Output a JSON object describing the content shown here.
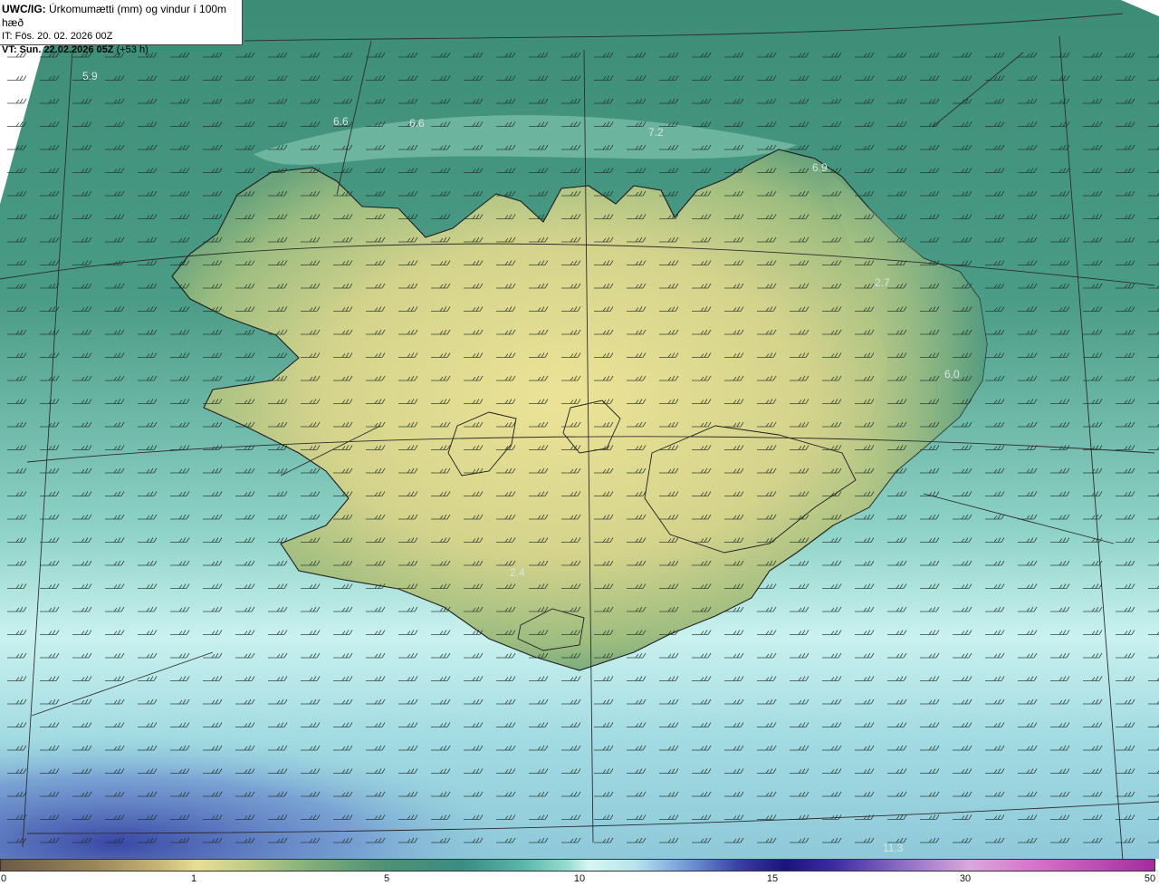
{
  "header": {
    "title_bold": "UWC/IG:",
    "title_rest": "Úrkomumætti (mm) og vindur í 100m hæð",
    "it_line": "IT: Fös. 20. 02. 2026 00Z",
    "vt_bold": "VT: Sun. 22.02.2026 05Z",
    "vt_rest": "(+53 h)"
  },
  "map_labels": {
    "v1": "5.9",
    "v2": "6.6",
    "v3": "6.6",
    "v4": "7.2",
    "v5": "6.9",
    "v6": "2.7",
    "v7": "6.0",
    "v8": "2.4",
    "v9": "11.3"
  },
  "colorbar": {
    "ticks": [
      "0",
      "1",
      "5",
      "10",
      "15",
      "30",
      "50"
    ]
  },
  "colors": {
    "land_high": "#e8df94",
    "land_low": "#6aa37c",
    "sea_north": "#3f8a78",
    "sea_south_cyan": "#c9f1ef",
    "sea_deep_blue": "#3d52a8",
    "coast": "#222222"
  }
}
